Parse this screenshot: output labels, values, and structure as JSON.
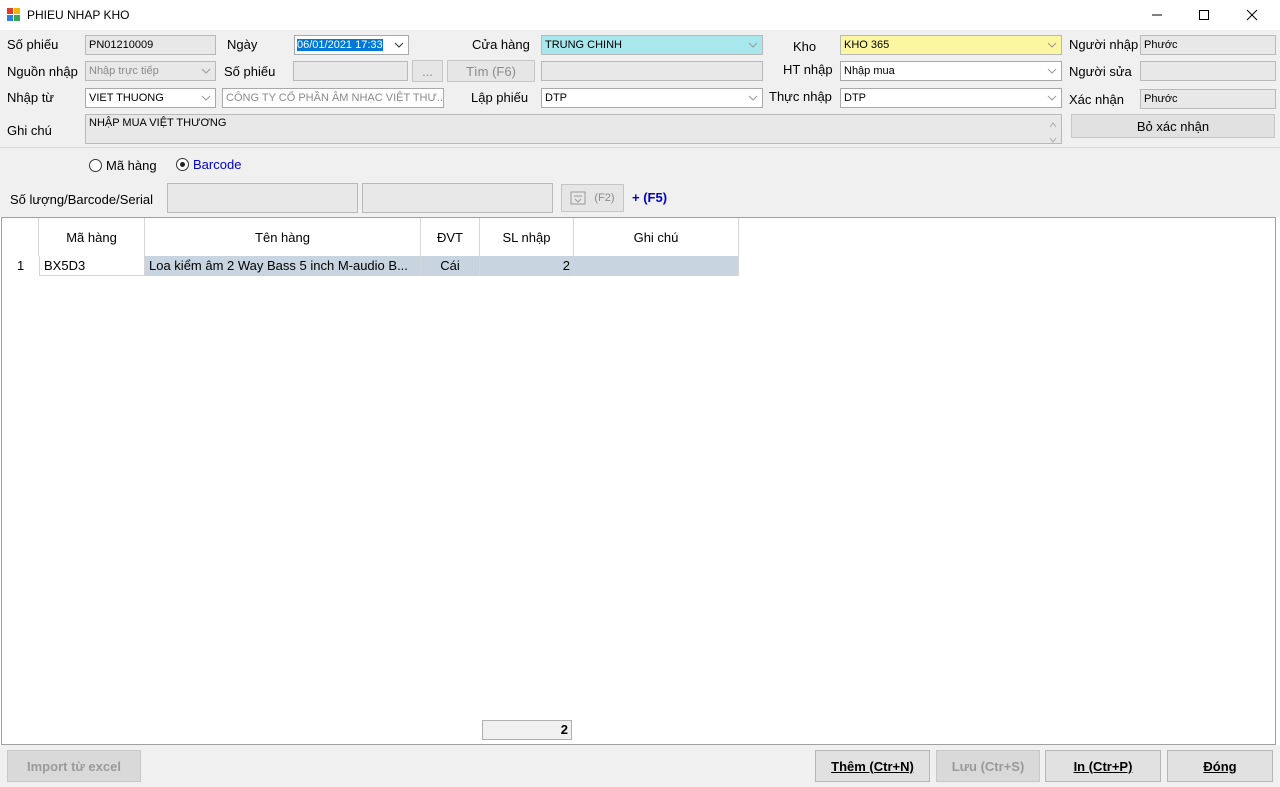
{
  "window": {
    "title": "PHIEU NHAP KHO",
    "minimize_glyph": "—",
    "maximize_glyph": "☐",
    "close_glyph": "✕"
  },
  "form": {
    "so_phieu_label": "Số phiếu",
    "so_phieu_value": "PN01210009",
    "ngay_label": "Ngày",
    "ngay_value": "06/01/2021 17:33",
    "cua_hang_label": "Cửa hàng",
    "cua_hang_value": "TRUNG CHINH",
    "kho_label": "Kho",
    "kho_value": "KHO 365",
    "nguoi_nhap_label": "Người nhập",
    "nguoi_nhap_value": "Phước",
    "nguon_nhap_label": "Nguồn nhập",
    "nguon_nhap_value": "Nhập trực tiếp",
    "so_phieu2_label": "Số phiếu",
    "so_phieu2_value": "",
    "browse_label": "...",
    "tim_label": "Tìm (F6)",
    "tim_result_value": "",
    "ht_nhap_label": "HT nhập",
    "ht_nhap_value": "Nhập mua",
    "nguoi_sua_label": "Người sửa",
    "nguoi_sua_value": "",
    "nhap_tu_label": "Nhập từ",
    "nhap_tu_value": "VIET THUONG",
    "nhap_tu_name": "CÔNG TY CỔ PHẦN ÂM NHẠC VIỆT THƯ...",
    "lap_phieu_label": "Lập phiếu",
    "lap_phieu_value": "DTP",
    "thuc_nhap_label": "Thực nhập",
    "thuc_nhap_value": "DTP",
    "xac_nhan_label": "Xác nhận",
    "xac_nhan_value": "Phước",
    "ghi_chu_label": "Ghi chú",
    "ghi_chu_value": "NHẬP MUA VIỆT THƯƠNG",
    "bo_xac_nhan_label": "Bỏ xác nhận"
  },
  "mode": {
    "ma_hang_label": "Mã hàng",
    "barcode_label": "Barcode",
    "selected": "Barcode"
  },
  "entry": {
    "label": "Số lượng/Barcode/Serial",
    "qty_value": "",
    "barcode_value": "",
    "f2_label": "(F2)",
    "f5_label": "+ (F5)"
  },
  "grid": {
    "columns": [
      "Mã hàng",
      "Tên hàng",
      "ĐVT",
      "SL nhập",
      "Ghi chú"
    ],
    "rows": [
      {
        "index": "1",
        "ma_hang": "BX5D3",
        "ten_hang": "Loa kiểm âm 2 Way Bass 5 inch M-audio B...",
        "dvt": "Cái",
        "sl_nhap": "2",
        "ghi_chu": ""
      }
    ],
    "total_sl": "2"
  },
  "footer": {
    "import_label": "Import từ excel",
    "them_label": "Thêm (Ctr+N)",
    "luu_label": "Lưu (Ctr+S)",
    "in_label": "In (Ctr+P)",
    "dong_label": "Đóng"
  },
  "colors": {
    "cua_hang_bg": "#a8e8ec",
    "kho_bg": "#fbf6a0",
    "selection_bg": "#c8d4e0",
    "accent_blue": "#0000cc",
    "date_highlight": "#0078d7"
  }
}
